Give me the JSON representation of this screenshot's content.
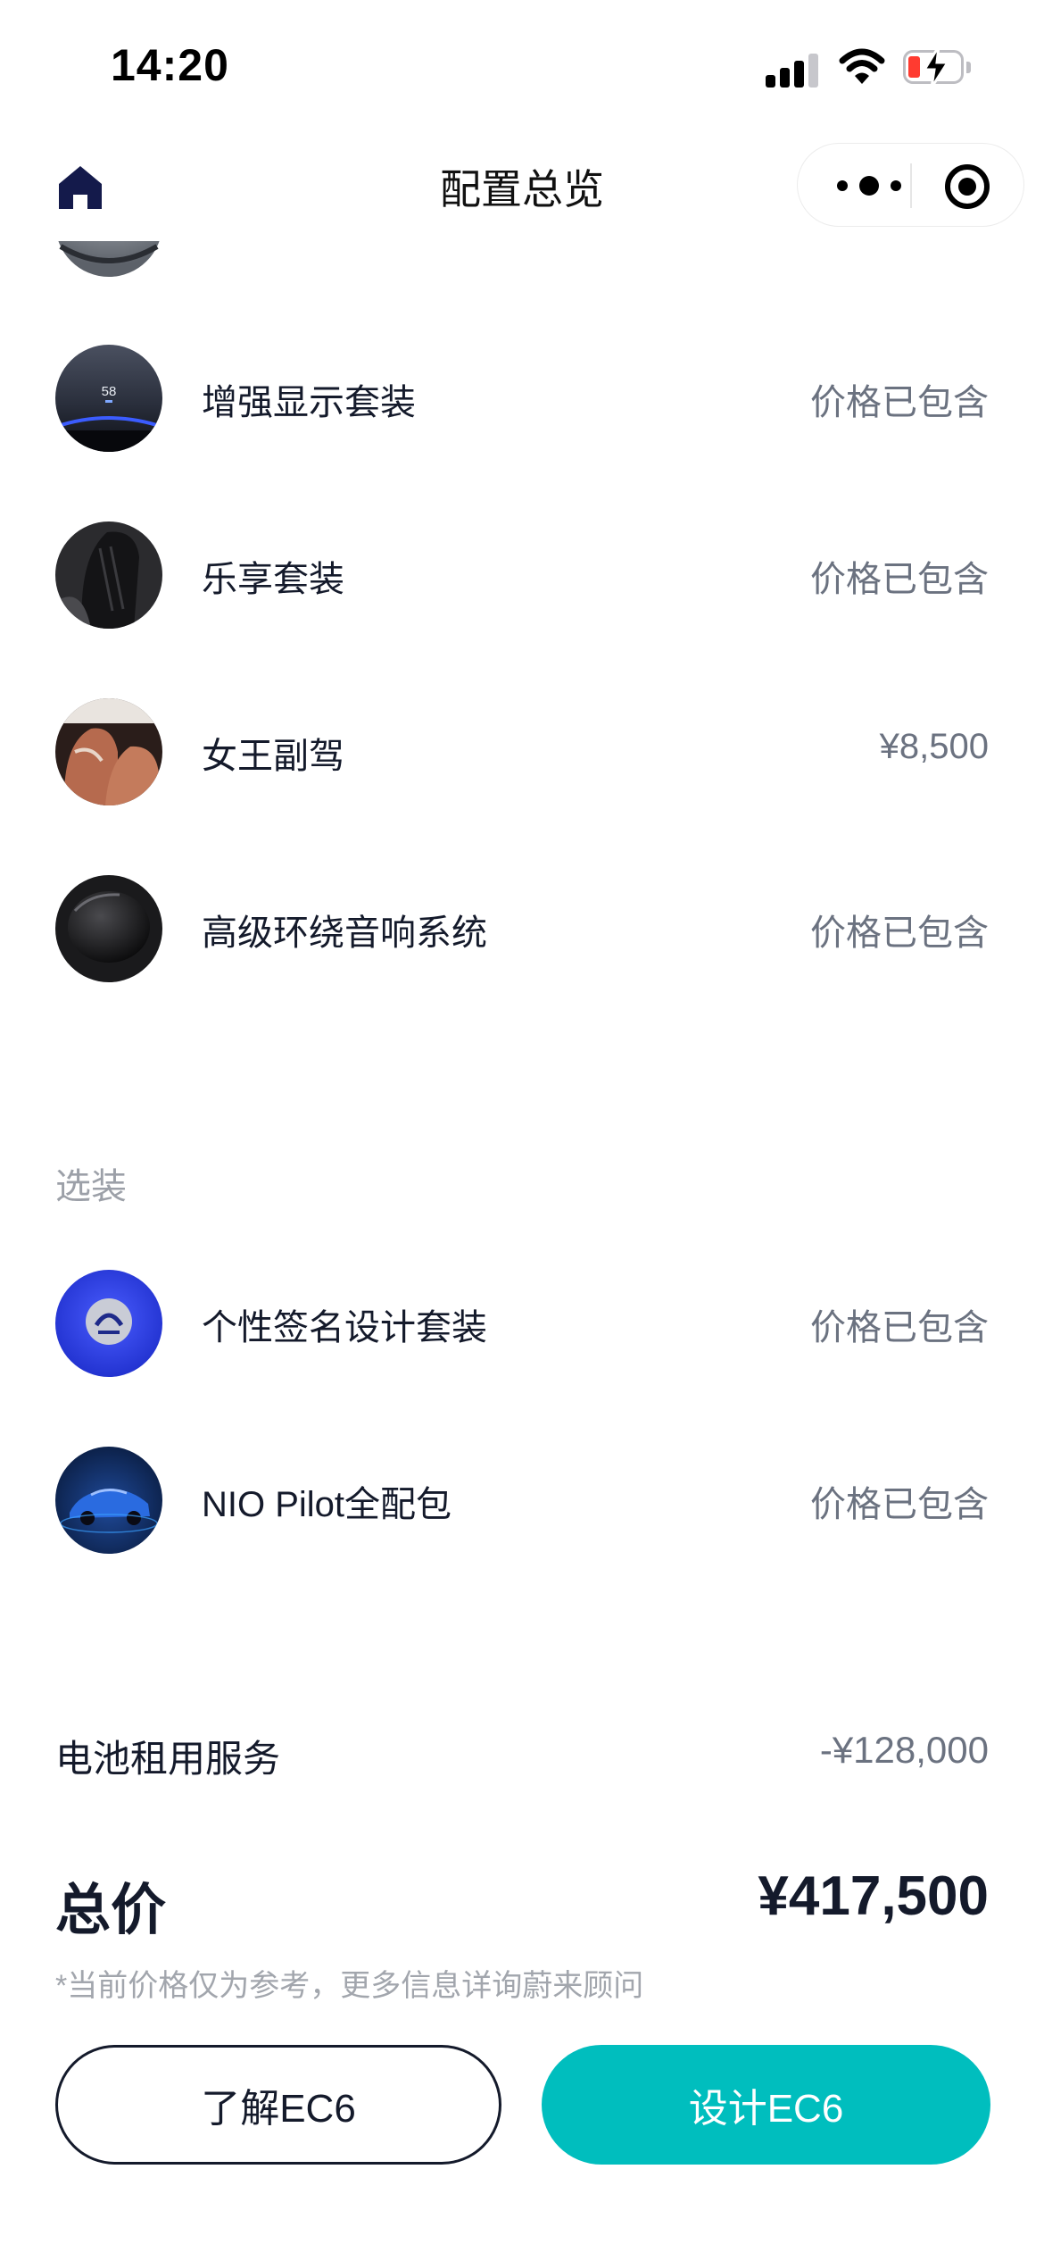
{
  "status_bar": {
    "time": "14:20"
  },
  "nav": {
    "title": "配置总览"
  },
  "standard_items": [
    {
      "label": "增强显示套装",
      "price": "价格已包含",
      "icon": "hud-display-thumb"
    },
    {
      "label": "乐享套装",
      "price": "价格已包含",
      "icon": "seat-thumb"
    },
    {
      "label": "女王副驾",
      "price": "¥8,500",
      "icon": "passenger-seat-thumb"
    },
    {
      "label": "高级环绕音响系统",
      "price": "价格已包含",
      "icon": "speaker-thumb"
    }
  ],
  "hud_speed_text": "58",
  "optional_section": {
    "title": "选装",
    "items": [
      {
        "label": "个性签名设计套装",
        "price": "价格已包含",
        "icon": "nio-badge-thumb"
      },
      {
        "label": "NIO Pilot全配包",
        "price": "价格已包含",
        "icon": "car-thumb"
      }
    ]
  },
  "battery_service": {
    "label": "电池租用服务",
    "value": "-¥128,000"
  },
  "total": {
    "label": "总价",
    "value": "¥417,500"
  },
  "disclaimer": "*当前价格仅为参考，更多信息详询蔚来顾问",
  "buttons": {
    "learn": "了解EC6",
    "design": "设计EC6"
  },
  "colors": {
    "accent": "#00bebe",
    "text": "#141a2b",
    "muted": "#6b7280"
  }
}
